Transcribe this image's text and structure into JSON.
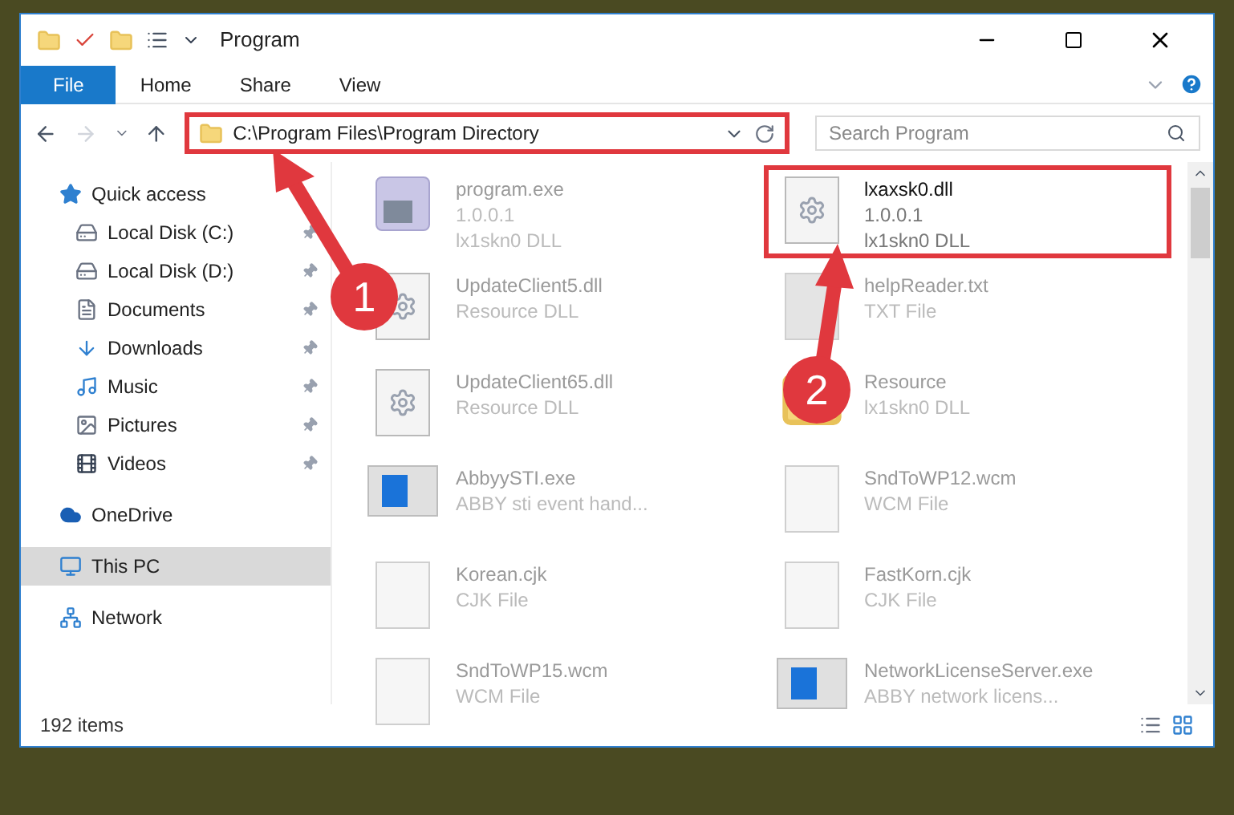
{
  "window": {
    "title": "Program"
  },
  "ribbon": {
    "tabs": [
      {
        "label": "File",
        "selected": true
      },
      {
        "label": "Home",
        "selected": false
      },
      {
        "label": "Share",
        "selected": false
      },
      {
        "label": "View",
        "selected": false
      }
    ]
  },
  "address": {
    "path": "C:\\Program Files\\Program Directory",
    "highlighted": true
  },
  "search": {
    "placeholder": "Search Program"
  },
  "sidebar": {
    "items": [
      {
        "label": "Quick access",
        "kind": "quick",
        "selected": false,
        "pinned": false,
        "children": [
          {
            "label": "Local Disk (C:)",
            "kind": "disk",
            "selected": false,
            "pinned": true
          },
          {
            "label": "Local Disk (D:)",
            "kind": "disk",
            "selected": false,
            "pinned": true
          },
          {
            "label": "Documents",
            "kind": "documents",
            "selected": false,
            "pinned": true
          },
          {
            "label": "Downloads",
            "kind": "downloads",
            "selected": false,
            "pinned": true
          },
          {
            "label": "Music",
            "kind": "music",
            "selected": false,
            "pinned": true
          },
          {
            "label": "Pictures",
            "kind": "pictures",
            "selected": false,
            "pinned": true
          },
          {
            "label": "Videos",
            "kind": "videos",
            "selected": false,
            "pinned": true
          }
        ]
      },
      {
        "label": "OneDrive",
        "kind": "cloud",
        "selected": false,
        "pinned": false
      },
      {
        "label": "This PC",
        "kind": "pc",
        "selected": true,
        "pinned": false
      },
      {
        "label": "Network",
        "kind": "network",
        "selected": false,
        "pinned": false
      }
    ]
  },
  "files": [
    {
      "name": "program.exe",
      "lines": [
        "1.0.0.1",
        "lx1skn0 DLL"
      ],
      "kind": "exe",
      "highlighted": false
    },
    {
      "name": "lxaxsk0.dll",
      "lines": [
        "1.0.0.1",
        "lx1skn0 DLL"
      ],
      "kind": "dll",
      "highlighted": true
    },
    {
      "name": "UpdateClient5.dll",
      "lines": [
        "Resource DLL"
      ],
      "kind": "dll",
      "highlighted": false
    },
    {
      "name": "helpReader.txt",
      "lines": [
        "TXT File"
      ],
      "kind": "txt",
      "highlighted": false
    },
    {
      "name": "UpdateClient65.dll",
      "lines": [
        "Resource DLL"
      ],
      "kind": "dll",
      "highlighted": false
    },
    {
      "name": "Resource",
      "lines": [
        "lx1skn0 DLL"
      ],
      "kind": "folder",
      "highlighted": false
    },
    {
      "name": "AbbyySTI.exe",
      "lines": [
        "ABBY sti event hand..."
      ],
      "kind": "app",
      "highlighted": false
    },
    {
      "name": "SndToWP12.wcm",
      "lines": [
        "WCM File"
      ],
      "kind": "blank",
      "highlighted": false
    },
    {
      "name": "Korean.cjk",
      "lines": [
        "CJK File"
      ],
      "kind": "blank",
      "highlighted": false
    },
    {
      "name": "FastKorn.cjk",
      "lines": [
        "CJK File"
      ],
      "kind": "blank",
      "highlighted": false
    },
    {
      "name": "SndToWP15.wcm",
      "lines": [
        "WCM File"
      ],
      "kind": "blank",
      "highlighted": false
    },
    {
      "name": "NetworkLicenseServer.exe",
      "lines": [
        "ABBY network licens..."
      ],
      "kind": "app",
      "highlighted": false
    }
  ],
  "status_bar": {
    "count": "192 items"
  },
  "annotations": [
    {
      "number": "1"
    },
    {
      "number": "2"
    }
  ]
}
